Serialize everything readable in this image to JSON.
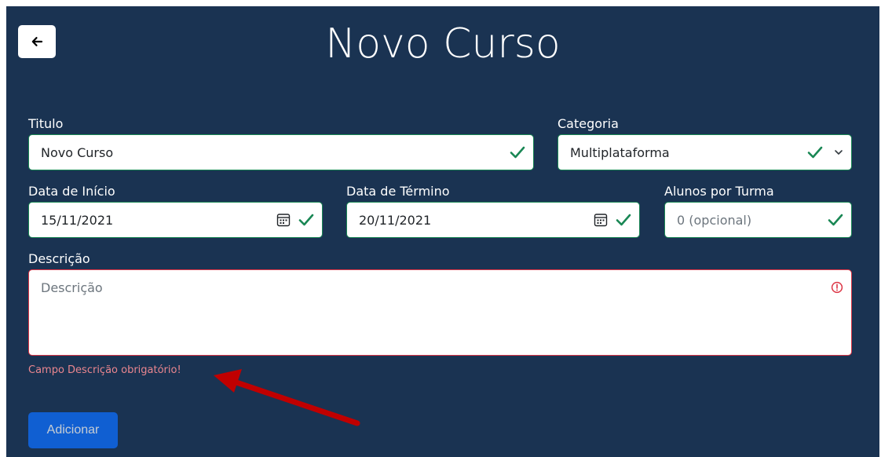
{
  "header": {
    "title": "Novo Curso"
  },
  "form": {
    "titulo": {
      "label": "Titulo",
      "value": "Novo Curso"
    },
    "categoria": {
      "label": "Categoria",
      "value": "Multiplataforma"
    },
    "data_inicio": {
      "label": "Data de Início",
      "value": "15/11/2021"
    },
    "data_termino": {
      "label": "Data de Término",
      "value": "20/11/2021"
    },
    "alunos": {
      "label": "Alunos por Turma",
      "placeholder": "0 (opcional)"
    },
    "descricao": {
      "label": "Descrição",
      "placeholder": "Descrição",
      "error": "Campo Descrição obrigatório!"
    },
    "submit_label": "Adicionar"
  },
  "colors": {
    "panel_bg": "#1a3352",
    "valid": "#198754",
    "invalid": "#dc3545",
    "primary": "#0d6efd",
    "annotation_arrow": "#c00000"
  },
  "icons": {
    "back": "arrow-left-icon",
    "valid": "check-icon",
    "calendar": "calendar-icon",
    "dropdown": "chevron-down-icon",
    "error": "exclamation-circle-icon"
  }
}
